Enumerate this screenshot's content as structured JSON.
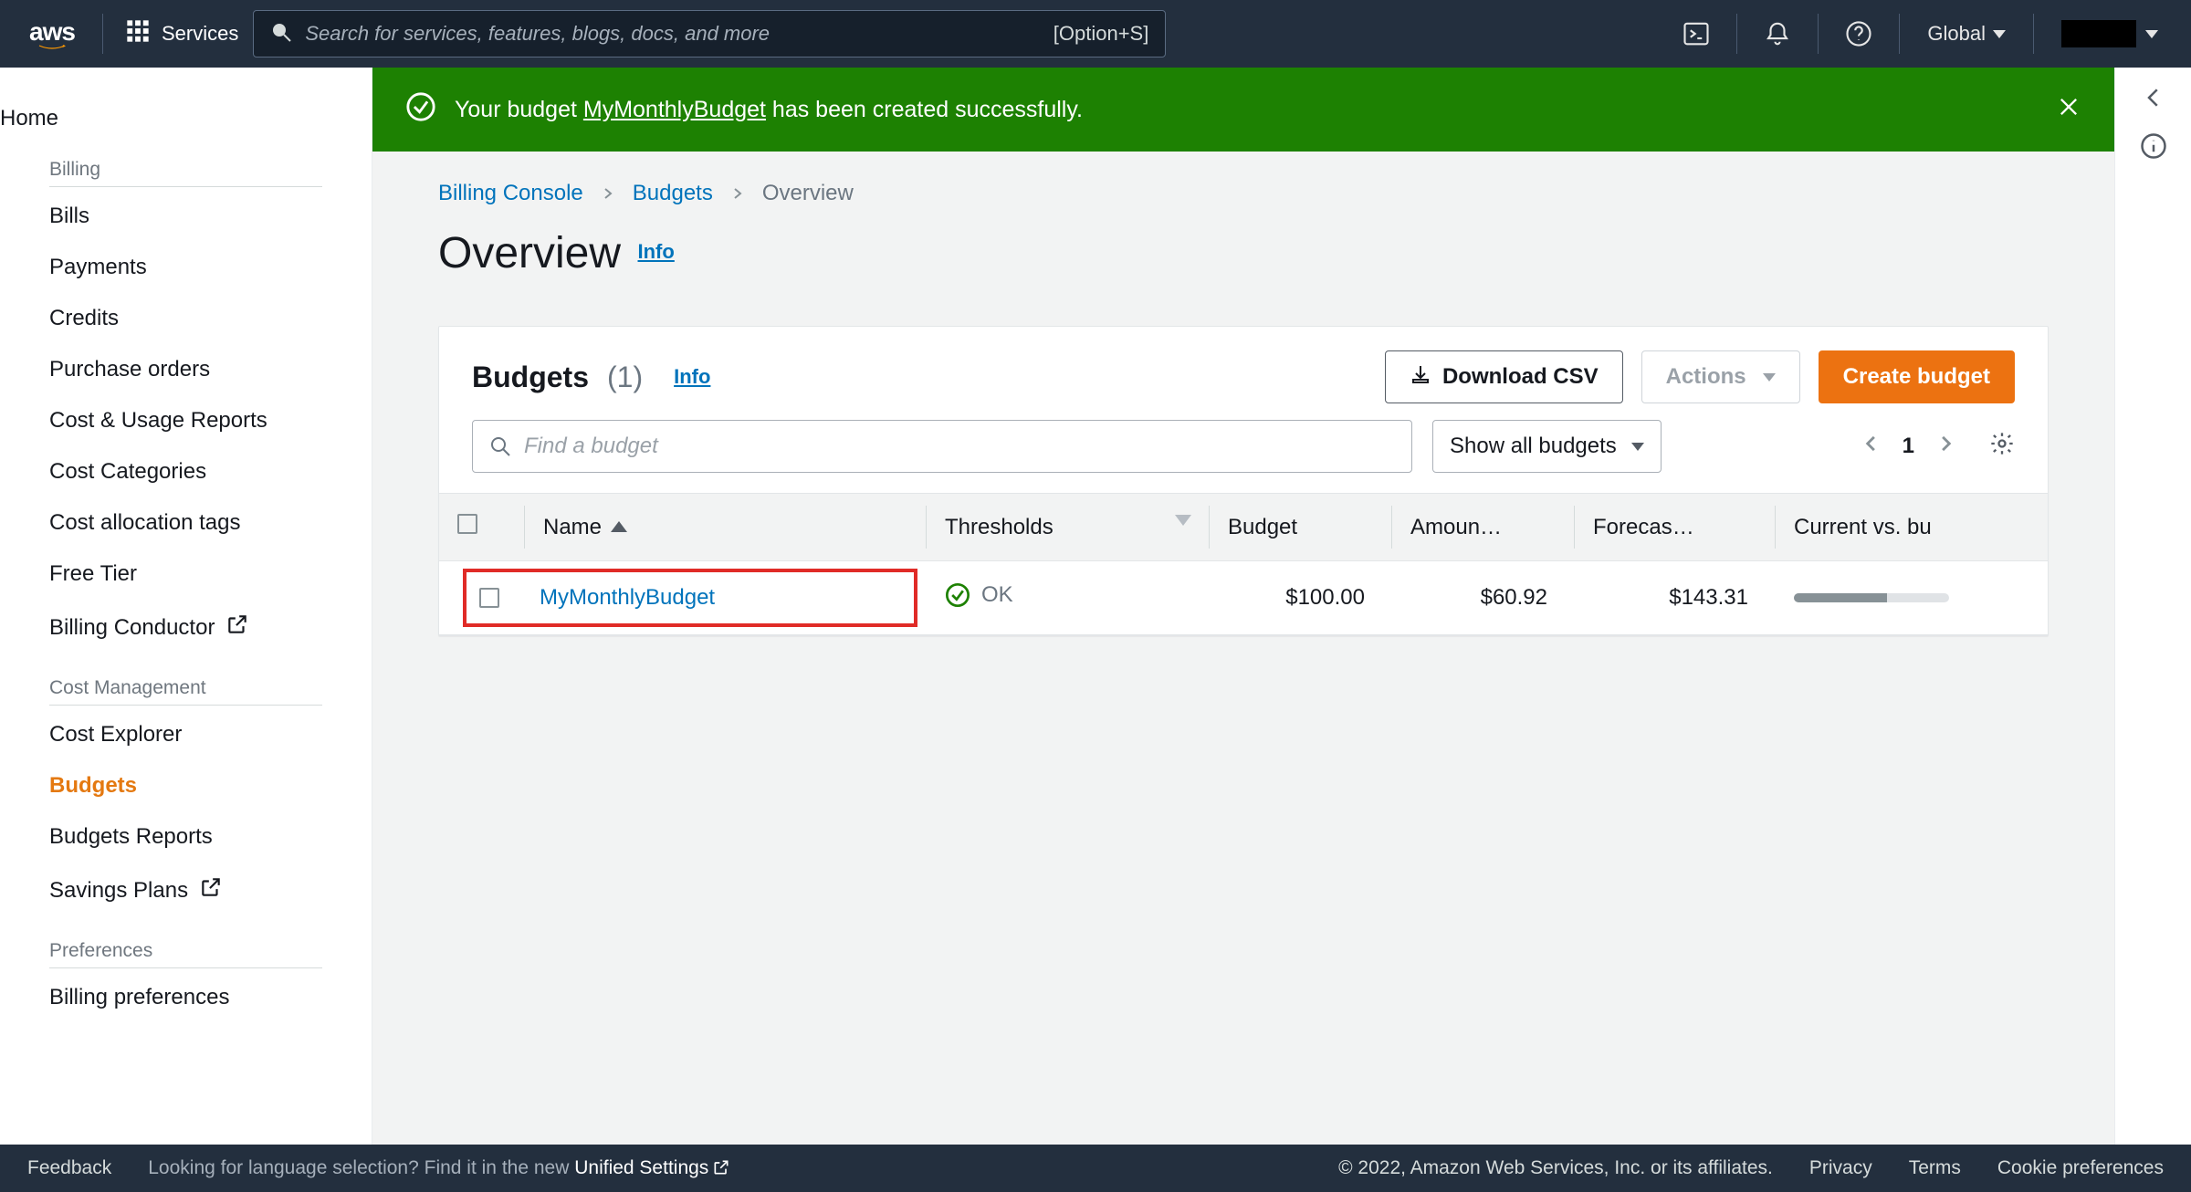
{
  "topnav": {
    "services_label": "Services",
    "search_placeholder": "Search for services, features, blogs, docs, and more",
    "search_hint": "[Option+S]",
    "region": "Global"
  },
  "sidebar": {
    "home": "Home",
    "billing": {
      "title": "Billing",
      "items": [
        "Bills",
        "Payments",
        "Credits",
        "Purchase orders",
        "Cost & Usage Reports",
        "Cost Categories",
        "Cost allocation tags",
        "Free Tier",
        "Billing Conductor"
      ]
    },
    "costmgmt": {
      "title": "Cost Management",
      "items": [
        "Cost Explorer",
        "Budgets",
        "Budgets Reports",
        "Savings Plans"
      ]
    },
    "prefs": {
      "title": "Preferences",
      "items": [
        "Billing preferences"
      ]
    }
  },
  "banner": {
    "prefix": "Your budget ",
    "link": "MyMonthlyBudget",
    "suffix": " has been created successfully."
  },
  "breadcrumb": {
    "root": "Billing Console",
    "mid": "Budgets",
    "current": "Overview"
  },
  "page": {
    "title": "Overview",
    "info": "Info"
  },
  "card": {
    "title": "Budgets",
    "count": "(1)",
    "info": "Info",
    "download": "Download CSV",
    "actions": "Actions",
    "create": "Create budget",
    "find_placeholder": "Find a budget",
    "filter": "Show all budgets",
    "page": "1"
  },
  "table": {
    "cols": [
      "Name",
      "Thresholds",
      "Budget",
      "Amoun…",
      "Forecas…",
      "Current vs. bu"
    ],
    "rows": [
      {
        "name": "MyMonthlyBudget",
        "threshold": "OK",
        "budget": "$100.00",
        "amount": "$60.92",
        "forecast": "$143.31"
      }
    ]
  },
  "footer": {
    "feedback": "Feedback",
    "lang_prefix": "Looking for language selection? Find it in the new ",
    "lang_link": "Unified Settings",
    "copyright": "© 2022, Amazon Web Services, Inc. or its affiliates.",
    "privacy": "Privacy",
    "terms": "Terms",
    "cookies": "Cookie preferences"
  }
}
